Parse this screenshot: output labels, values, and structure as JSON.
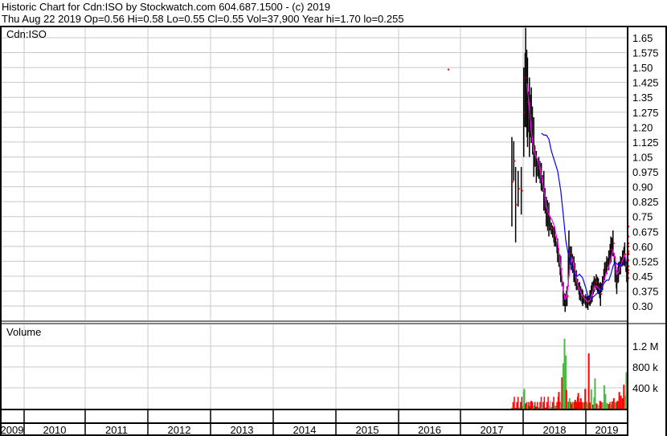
{
  "header": {
    "line1": "Historic Chart for Cdn:ISO by Stockwatch.com 604.687.1500 - (c) 2019",
    "line2": "Thu Aug 22 2019  Op=0.56  Hi=0.58  Lo=0.55  Cl=0.55  Vol=37,900  Year hi=1.70  lo=0.255"
  },
  "colors": {
    "up": "#4cb848",
    "down": "#ff0000",
    "neutral": "#aaaaaa",
    "price": "#000000",
    "tick": "#ff0000",
    "ma_short": "#ff00ff",
    "ma_long": "#0000ff",
    "grid": "#c8c8c8"
  },
  "chart_data": [
    {
      "type": "line",
      "title": "Cdn:ISO",
      "ylim": [
        0.255,
        1.72
      ],
      "y_ticks": [
        "1.65",
        "1.575",
        "1.50",
        "1.425",
        "1.35",
        "1.275",
        "1.20",
        "1.125",
        "1.05",
        "0.975",
        "0.90",
        "0.825",
        "0.75",
        "0.675",
        "0.60",
        "0.525",
        "0.45",
        "0.375",
        "0.30"
      ],
      "x_ticks": [
        "2009",
        "2010",
        "2011",
        "2012",
        "2013",
        "2014",
        "2015",
        "2016",
        "2017",
        "2018",
        "2019"
      ],
      "xlim": [
        2009.0,
        2019.67
      ],
      "grid": true,
      "series_price_hl": [
        [
          2016.82,
          1.15,
          0.7
        ],
        [
          2016.85,
          1.13,
          0.93
        ],
        [
          2016.88,
          1.0,
          0.62
        ],
        [
          2016.92,
          0.98,
          0.8
        ],
        [
          2016.97,
          1.0,
          0.76
        ],
        [
          2017.01,
          1.5,
          1.05
        ],
        [
          2017.04,
          1.7,
          1.2
        ],
        [
          2017.07,
          1.55,
          1.1
        ],
        [
          2017.1,
          1.45,
          1.05
        ],
        [
          2017.13,
          1.4,
          1.12
        ],
        [
          2017.17,
          1.25,
          0.95
        ],
        [
          2017.21,
          1.08,
          0.92
        ],
        [
          2017.25,
          1.05,
          0.94
        ],
        [
          2017.29,
          1.02,
          0.88
        ],
        [
          2017.33,
          0.98,
          0.78
        ],
        [
          2017.37,
          0.85,
          0.7
        ],
        [
          2017.41,
          0.82,
          0.65
        ],
        [
          2017.45,
          0.72,
          0.66
        ],
        [
          2017.5,
          0.7,
          0.6
        ],
        [
          2017.55,
          0.64,
          0.52
        ],
        [
          2017.6,
          0.55,
          0.42
        ],
        [
          2017.64,
          0.42,
          0.3
        ],
        [
          2017.67,
          0.36,
          0.27
        ],
        [
          2017.7,
          0.4,
          0.3
        ],
        [
          2017.73,
          0.68,
          0.45
        ],
        [
          2017.77,
          0.6,
          0.48
        ],
        [
          2017.81,
          0.55,
          0.42
        ],
        [
          2017.85,
          0.48,
          0.38
        ],
        [
          2017.9,
          0.42,
          0.33
        ],
        [
          2017.95,
          0.38,
          0.3
        ],
        [
          2018.0,
          0.36,
          0.29
        ],
        [
          2018.05,
          0.35,
          0.28
        ],
        [
          2018.1,
          0.38,
          0.3
        ],
        [
          2018.15,
          0.42,
          0.32
        ],
        [
          2018.2,
          0.45,
          0.37
        ],
        [
          2018.25,
          0.46,
          0.38
        ],
        [
          2018.3,
          0.44,
          0.36
        ],
        [
          2018.35,
          0.42,
          0.3
        ],
        [
          2018.4,
          0.45,
          0.38
        ],
        [
          2018.45,
          0.52,
          0.43
        ],
        [
          2018.5,
          0.55,
          0.46
        ],
        [
          2018.55,
          0.58,
          0.48
        ],
        [
          2018.6,
          0.65,
          0.52
        ],
        [
          2018.65,
          0.68,
          0.55
        ],
        [
          2018.7,
          0.55,
          0.42
        ],
        [
          2018.74,
          0.48,
          0.36
        ],
        [
          2018.78,
          0.52,
          0.42
        ],
        [
          2018.83,
          0.55,
          0.46
        ],
        [
          2018.88,
          0.58,
          0.5
        ],
        [
          2018.93,
          0.62,
          0.5
        ],
        [
          2018.98,
          0.5,
          0.42
        ],
        [
          2019.02,
          0.48,
          0.4
        ],
        [
          2019.07,
          0.52,
          0.44
        ],
        [
          2019.12,
          0.55,
          0.45
        ],
        [
          2019.17,
          0.55,
          0.38
        ],
        [
          2019.22,
          0.52,
          0.44
        ],
        [
          2019.27,
          0.58,
          0.48
        ],
        [
          2019.32,
          0.62,
          0.5
        ],
        [
          2019.37,
          0.65,
          0.55
        ],
        [
          2019.42,
          0.68,
          0.55
        ],
        [
          2019.47,
          0.62,
          0.5
        ],
        [
          2019.52,
          0.75,
          0.55
        ],
        [
          2019.56,
          0.8,
          0.6
        ],
        [
          2019.6,
          0.62,
          0.53
        ],
        [
          2019.64,
          0.58,
          0.55
        ]
      ],
      "series_ma_short": [
        [
          2017.06,
          1.42
        ],
        [
          2017.1,
          1.3
        ],
        [
          2017.13,
          1.18
        ],
        [
          2017.17,
          1.08
        ],
        [
          2017.21,
          1.05
        ],
        [
          2017.25,
          1.02
        ],
        [
          2017.29,
          0.96
        ],
        [
          2017.33,
          0.88
        ],
        [
          2017.37,
          0.8
        ],
        [
          2017.41,
          0.76
        ],
        [
          2017.45,
          0.74
        ],
        [
          2017.5,
          0.7
        ],
        [
          2017.55,
          0.62
        ],
        [
          2017.6,
          0.5
        ],
        [
          2017.64,
          0.38
        ],
        [
          2017.67,
          0.33
        ],
        [
          2017.7,
          0.36
        ],
        [
          2017.74,
          0.48
        ],
        [
          2017.78,
          0.54
        ],
        [
          2017.82,
          0.5
        ],
        [
          2017.86,
          0.42
        ],
        [
          2017.9,
          0.38
        ],
        [
          2017.95,
          0.35
        ],
        [
          2018.0,
          0.33
        ],
        [
          2018.05,
          0.32
        ],
        [
          2018.1,
          0.33
        ],
        [
          2018.15,
          0.36
        ],
        [
          2018.2,
          0.4
        ],
        [
          2018.25,
          0.4
        ],
        [
          2018.3,
          0.39
        ],
        [
          2018.35,
          0.38
        ],
        [
          2018.4,
          0.4
        ],
        [
          2018.45,
          0.44
        ],
        [
          2018.5,
          0.47
        ],
        [
          2018.55,
          0.5
        ],
        [
          2018.6,
          0.54
        ],
        [
          2018.65,
          0.58
        ],
        [
          2018.7,
          0.54
        ],
        [
          2018.74,
          0.46
        ],
        [
          2018.78,
          0.47
        ],
        [
          2018.83,
          0.5
        ],
        [
          2018.88,
          0.53
        ],
        [
          2018.93,
          0.56
        ],
        [
          2018.98,
          0.52
        ],
        [
          2019.05,
          0.47
        ],
        [
          2019.12,
          0.48
        ],
        [
          2019.17,
          0.46
        ],
        [
          2019.22,
          0.47
        ],
        [
          2019.3,
          0.52
        ],
        [
          2019.38,
          0.55
        ],
        [
          2019.45,
          0.56
        ],
        [
          2019.52,
          0.56
        ],
        [
          2019.58,
          0.62
        ],
        [
          2019.64,
          0.61
        ]
      ],
      "series_ma_long": [
        [
          2017.29,
          1.17
        ],
        [
          2017.33,
          1.16
        ],
        [
          2017.37,
          1.16
        ],
        [
          2017.41,
          1.14
        ],
        [
          2017.45,
          1.08
        ],
        [
          2017.5,
          1.03
        ],
        [
          2017.55,
          0.98
        ],
        [
          2017.6,
          0.88
        ],
        [
          2017.64,
          0.76
        ],
        [
          2017.68,
          0.63
        ],
        [
          2017.72,
          0.56
        ],
        [
          2017.77,
          0.5
        ],
        [
          2017.82,
          0.46
        ],
        [
          2017.86,
          0.45
        ],
        [
          2017.9,
          0.46
        ],
        [
          2017.95,
          0.44
        ],
        [
          2018.0,
          0.39
        ],
        [
          2018.05,
          0.35
        ],
        [
          2018.1,
          0.34
        ],
        [
          2018.15,
          0.34
        ],
        [
          2018.2,
          0.35
        ],
        [
          2018.25,
          0.36
        ],
        [
          2018.3,
          0.37
        ],
        [
          2018.35,
          0.38
        ],
        [
          2018.4,
          0.4
        ],
        [
          2018.45,
          0.42
        ],
        [
          2018.5,
          0.43
        ],
        [
          2018.55,
          0.43
        ],
        [
          2018.6,
          0.46
        ],
        [
          2018.65,
          0.5
        ],
        [
          2018.7,
          0.52
        ],
        [
          2018.75,
          0.51
        ],
        [
          2018.8,
          0.51
        ],
        [
          2018.85,
          0.5
        ],
        [
          2018.9,
          0.51
        ],
        [
          2018.95,
          0.52
        ],
        [
          2019.0,
          0.52
        ],
        [
          2019.1,
          0.51
        ],
        [
          2019.2,
          0.5
        ],
        [
          2019.3,
          0.5
        ],
        [
          2019.4,
          0.51
        ],
        [
          2019.5,
          0.52
        ],
        [
          2019.6,
          0.53
        ],
        [
          2019.64,
          0.53
        ]
      ]
    },
    {
      "type": "bar",
      "title": "Volume",
      "ylim": [
        0,
        1500000
      ],
      "y_ticks": [
        {
          "label": "1.2 M",
          "value": 1200000
        },
        {
          "label": "800 k",
          "value": 800000
        },
        {
          "label": "400 k",
          "value": 400000
        }
      ],
      "grid": true,
      "bars": [
        [
          2016.82,
          20000,
          "up"
        ],
        [
          2016.88,
          15000,
          "down"
        ],
        [
          2016.94,
          25000,
          "up"
        ],
        [
          2017.01,
          330000,
          "up"
        ],
        [
          2017.02,
          380000,
          "up"
        ],
        [
          2017.04,
          100000,
          "down"
        ],
        [
          2017.07,
          70000,
          "up"
        ],
        [
          2017.1,
          50000,
          "down"
        ],
        [
          2017.13,
          150000,
          "down"
        ],
        [
          2017.17,
          60000,
          "up"
        ],
        [
          2017.21,
          40000,
          "down"
        ],
        [
          2017.25,
          30000,
          "up"
        ],
        [
          2017.3,
          25000,
          "neutral"
        ],
        [
          2017.36,
          20000,
          "down"
        ],
        [
          2017.45,
          30000,
          "up"
        ],
        [
          2017.52,
          60000,
          "up"
        ],
        [
          2017.57,
          320000,
          "down"
        ],
        [
          2017.6,
          100000,
          "neutral"
        ],
        [
          2017.62,
          600000,
          "down"
        ],
        [
          2017.63,
          380000,
          "down"
        ],
        [
          2017.64,
          870000,
          "up"
        ],
        [
          2017.66,
          1340000,
          "up"
        ],
        [
          2017.68,
          1020000,
          "up"
        ],
        [
          2017.69,
          360000,
          "down"
        ],
        [
          2017.71,
          140000,
          "up"
        ],
        [
          2017.74,
          200000,
          "up"
        ],
        [
          2017.77,
          90000,
          "down"
        ],
        [
          2017.8,
          130000,
          "up"
        ],
        [
          2017.83,
          170000,
          "down"
        ],
        [
          2017.88,
          300000,
          "down"
        ],
        [
          2017.92,
          200000,
          "down"
        ],
        [
          2017.96,
          120000,
          "up"
        ],
        [
          2017.99,
          380000,
          "down"
        ],
        [
          2018.03,
          100000,
          "up"
        ],
        [
          2018.07,
          1060000,
          "down"
        ],
        [
          2018.1,
          120000,
          "down"
        ],
        [
          2018.13,
          370000,
          "up"
        ],
        [
          2018.17,
          80000,
          "down"
        ],
        [
          2018.2,
          220000,
          "up"
        ],
        [
          2018.22,
          580000,
          "up"
        ],
        [
          2018.26,
          100000,
          "down"
        ],
        [
          2018.3,
          70000,
          "neutral"
        ],
        [
          2018.34,
          150000,
          "down"
        ],
        [
          2018.4,
          120000,
          "up"
        ],
        [
          2018.44,
          450000,
          "up"
        ],
        [
          2018.47,
          280000,
          "up"
        ],
        [
          2018.51,
          110000,
          "up"
        ],
        [
          2018.55,
          90000,
          "down"
        ],
        [
          2018.6,
          80000,
          "up"
        ],
        [
          2018.63,
          140000,
          "down"
        ],
        [
          2018.67,
          200000,
          "down"
        ],
        [
          2018.71,
          120000,
          "up"
        ],
        [
          2018.76,
          150000,
          "down"
        ],
        [
          2018.8,
          320000,
          "down"
        ],
        [
          2018.84,
          250000,
          "down"
        ],
        [
          2018.88,
          200000,
          "down"
        ],
        [
          2018.91,
          460000,
          "down"
        ],
        [
          2018.94,
          250000,
          "up"
        ],
        [
          2018.97,
          700000,
          "up"
        ],
        [
          2019.0,
          180000,
          "down"
        ],
        [
          2019.02,
          1000000,
          "up"
        ],
        [
          2019.06,
          420000,
          "up"
        ],
        [
          2019.1,
          420000,
          "up"
        ],
        [
          2019.13,
          240000,
          "down"
        ],
        [
          2019.16,
          150000,
          "up"
        ],
        [
          2019.2,
          80000,
          "down"
        ],
        [
          2019.25,
          90000,
          "up"
        ],
        [
          2019.3,
          120000,
          "down"
        ],
        [
          2019.35,
          110000,
          "up"
        ],
        [
          2019.4,
          150000,
          "down"
        ],
        [
          2019.45,
          90000,
          "up"
        ],
        [
          2019.5,
          160000,
          "down"
        ],
        [
          2019.55,
          130000,
          "up"
        ],
        [
          2019.6,
          60000,
          "down"
        ],
        [
          2019.64,
          40000,
          "up"
        ]
      ]
    }
  ]
}
